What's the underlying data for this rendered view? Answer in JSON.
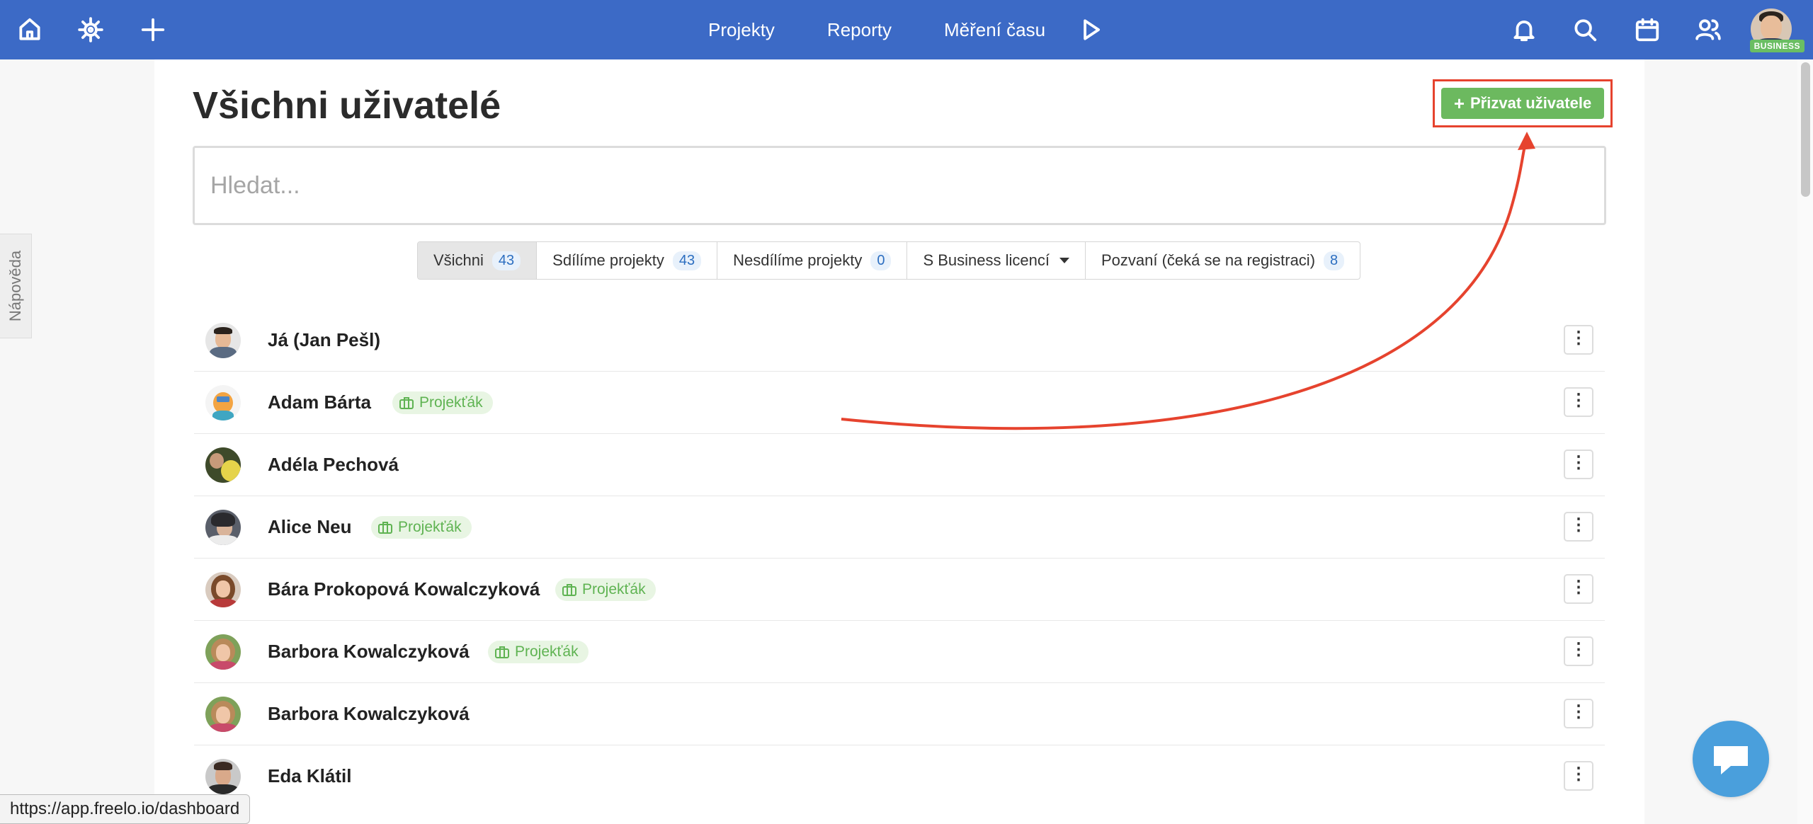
{
  "topbar": {
    "nav": [
      "Projekty",
      "Reporty",
      "Měření času"
    ],
    "badge": "BUSINESS"
  },
  "help_tab": "Nápověda",
  "page": {
    "title": "Všichni uživatelé",
    "invite_button": "Přizvat uživatele",
    "search_placeholder": "Hledat..."
  },
  "filters": [
    {
      "label": "Všichni",
      "count": "43",
      "active": true
    },
    {
      "label": "Sdílíme projekty",
      "count": "43"
    },
    {
      "label": "Nesdílíme projekty",
      "count": "0"
    },
    {
      "label": "S Business licencí",
      "dropdown": true
    },
    {
      "label": "Pozvaní (čeká se na registraci)",
      "count": "8"
    }
  ],
  "users": [
    {
      "name": "Já (Jan Pešl)",
      "tag": ""
    },
    {
      "name": "Adam Bárta",
      "tag": "Projekťák"
    },
    {
      "name": "Adéla Pechová",
      "tag": ""
    },
    {
      "name": "Alice Neu",
      "tag": "Projekťák"
    },
    {
      "name": "Bára Prokopová Kowalczyková",
      "tag": "Projekťák"
    },
    {
      "name": "Barbora Kowalczyková",
      "tag": "Projekťák"
    },
    {
      "name": "Barbora Kowalczyková",
      "tag": ""
    },
    {
      "name": "Eda Klátil",
      "tag": ""
    }
  ],
  "kebab_glyph": "⋮",
  "status_url": "https://app.freelo.io/dashboard",
  "colors": {
    "topbar": "#3c6ac6",
    "invite": "#6cb95f",
    "highlight": "#e6432e",
    "chat": "#4a9fdc"
  }
}
